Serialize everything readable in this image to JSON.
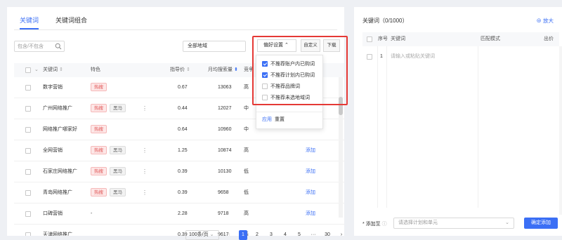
{
  "tabs": [
    "关键词",
    "关键词组合"
  ],
  "search": {
    "placeholder": "包含/不包含"
  },
  "region": {
    "value": "全部地域"
  },
  "pref": {
    "label": "偏好设置",
    "custom": "自定义",
    "download": "下载"
  },
  "pref_options": [
    {
      "label": "不推荐账户内已购词",
      "checked": true
    },
    {
      "label": "不推荐计划内已购词",
      "checked": true
    },
    {
      "label": "不推荐品牌词",
      "checked": false
    },
    {
      "label": "不推荐未选地域词",
      "checked": false
    }
  ],
  "pref_apply": "应用",
  "pref_reset": "重置",
  "table": {
    "headers": {
      "keyword": "关键词",
      "feature": "特色",
      "index": "指导价",
      "search": "月均搜索量",
      "competition": "竞争"
    },
    "rows": [
      {
        "keyword": "数字营销",
        "tags": [
          "热搜"
        ],
        "index": "0.67",
        "search": "13063",
        "competition": "高",
        "action": ""
      },
      {
        "keyword": "广州网络推广",
        "tags": [
          "热搜",
          "黑马"
        ],
        "index": "0.44",
        "search": "12027",
        "competition": "中",
        "action": ""
      },
      {
        "keyword": "网络推广哪家好",
        "tags": [
          "热搜"
        ],
        "index": "0.64",
        "search": "10960",
        "competition": "中",
        "action": ""
      },
      {
        "keyword": "全网营销",
        "tags": [
          "热搜",
          "黑马"
        ],
        "index": "1.25",
        "search": "10874",
        "competition": "高",
        "action": "添加"
      },
      {
        "keyword": "石家庄网络推广",
        "tags": [
          "热搜",
          "黑马"
        ],
        "index": "0.39",
        "search": "10130",
        "competition": "低",
        "action": "添加"
      },
      {
        "keyword": "青岛网络推广",
        "tags": [
          "热搜",
          "黑马"
        ],
        "index": "0.39",
        "search": "9658",
        "competition": "低",
        "action": "添加"
      },
      {
        "keyword": "口碑营销",
        "tags": [],
        "dash": "-",
        "index": "2.28",
        "search": "9718",
        "competition": "高",
        "action": "添加"
      }
    ],
    "partial_row": {
      "keyword": "天津网络推广",
      "index": "0.39",
      "search": "9617",
      "competition": "低"
    }
  },
  "pager": {
    "size": "100条/页",
    "pages": [
      "1",
      "2",
      "3",
      "4",
      "5",
      "···",
      "30"
    ],
    "current": "1"
  },
  "right": {
    "title": "关键词（0/1000）",
    "zoom": "放大",
    "headers": {
      "index": "序号",
      "keyword": "关键词",
      "match": "匹配模式",
      "bid": "出价"
    },
    "row": {
      "index": "1",
      "placeholder": "请输入或粘贴关键词"
    },
    "footer": {
      "label": "* 添加至",
      "select_placeholder": "请选择计划和单元",
      "confirm": "确定添加"
    }
  },
  "colors": {
    "accent": "#3b6ff5",
    "hot": "#e05555",
    "highlight": "#e53935"
  }
}
